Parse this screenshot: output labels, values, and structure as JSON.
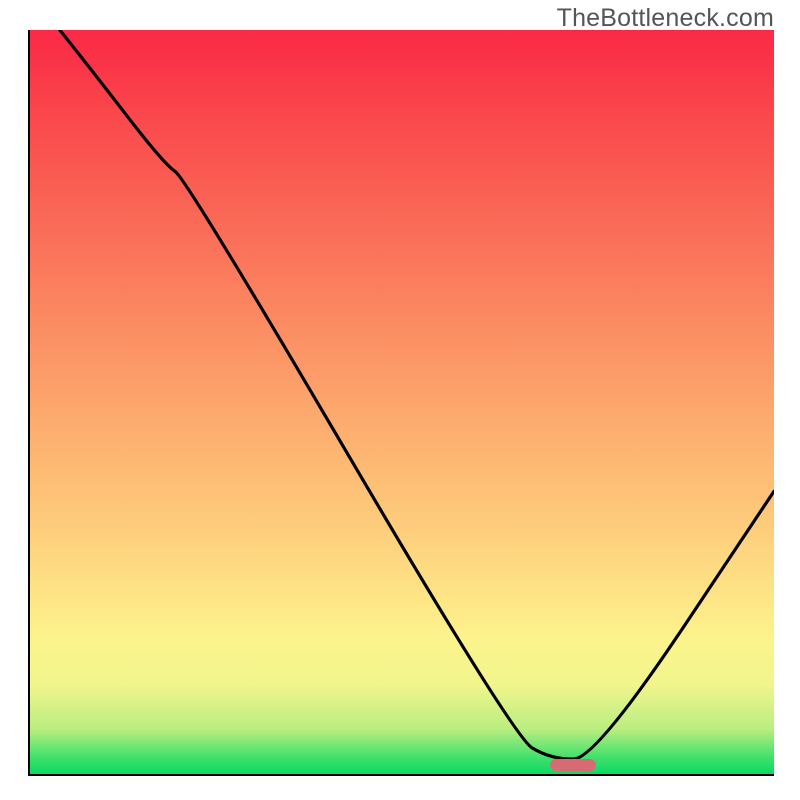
{
  "watermark": "TheBottleneck.com",
  "chart_data": {
    "type": "line",
    "title": "",
    "xlabel": "",
    "ylabel": "",
    "xlim": [
      0,
      100
    ],
    "ylim": [
      0,
      100
    ],
    "x": [
      0,
      8,
      18,
      21,
      65,
      70,
      76,
      100
    ],
    "values": [
      105,
      95,
      82,
      80,
      5,
      2,
      2,
      38
    ],
    "marker": {
      "x_center": 73,
      "y_center": 1.2,
      "width_pct": 6.2,
      "height_pct": 1.6
    },
    "annotations": []
  },
  "axes": {
    "show_left": true,
    "show_bottom": true
  },
  "grid": false
}
